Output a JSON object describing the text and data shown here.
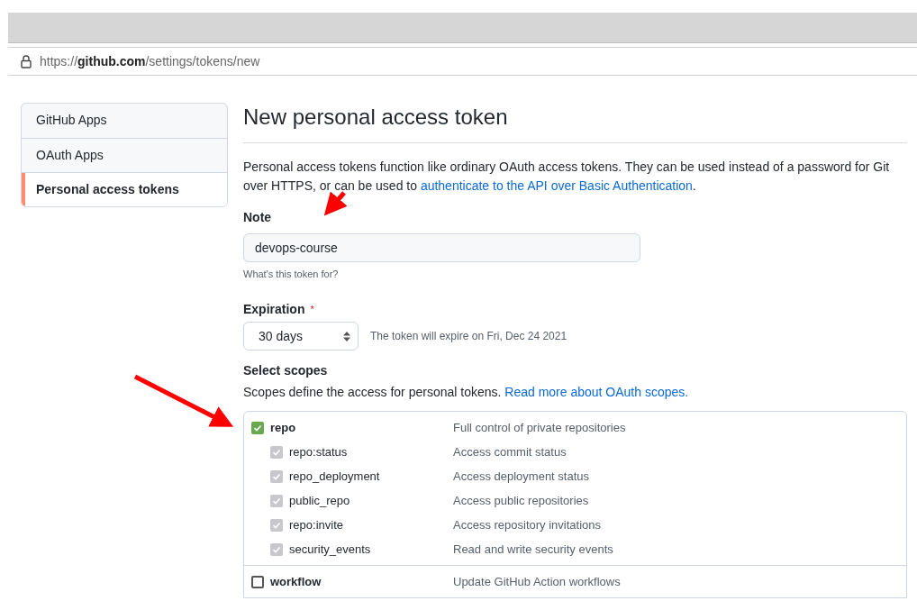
{
  "browser": {
    "url_scheme": "https://",
    "url_host": "github.com",
    "url_path": "/settings/tokens/new"
  },
  "sidebar": {
    "items": [
      {
        "label": "GitHub Apps",
        "selected": false
      },
      {
        "label": "OAuth Apps",
        "selected": false
      },
      {
        "label": "Personal access tokens",
        "selected": true
      }
    ]
  },
  "title": "New personal access token",
  "intro": "Personal access tokens function like ordinary OAuth access tokens. They can be used instead of a password for Git over HTTPS, or can be used to ",
  "intro_link": "authenticate to the API over Basic Authentication",
  "intro_end": ".",
  "note": {
    "label": "Note",
    "value": "devops-course",
    "hint": "What's this token for?"
  },
  "expiration": {
    "label": "Expiration",
    "required_mark": "*",
    "value": "30 days",
    "note": "The token will expire on Fri, Dec 24 2021"
  },
  "scopes": {
    "label": "Select scopes",
    "description": "Scopes define the access for personal tokens. ",
    "link": "Read more about OAuth scopes.",
    "items": [
      {
        "name": "repo",
        "description": "Full control of private repositories",
        "checked": true,
        "disabled": false,
        "children": [
          {
            "name": "repo:status",
            "description": "Access commit status",
            "checked": true,
            "disabled": true
          },
          {
            "name": "repo_deployment",
            "description": "Access deployment status",
            "checked": true,
            "disabled": true
          },
          {
            "name": "public_repo",
            "description": "Access public repositories",
            "checked": true,
            "disabled": true
          },
          {
            "name": "repo:invite",
            "description": "Access repository invitations",
            "checked": true,
            "disabled": true
          },
          {
            "name": "security_events",
            "description": "Read and write security events",
            "checked": true,
            "disabled": true
          }
        ]
      },
      {
        "name": "workflow",
        "description": "Update GitHub Action workflows",
        "checked": false,
        "disabled": false
      }
    ]
  }
}
